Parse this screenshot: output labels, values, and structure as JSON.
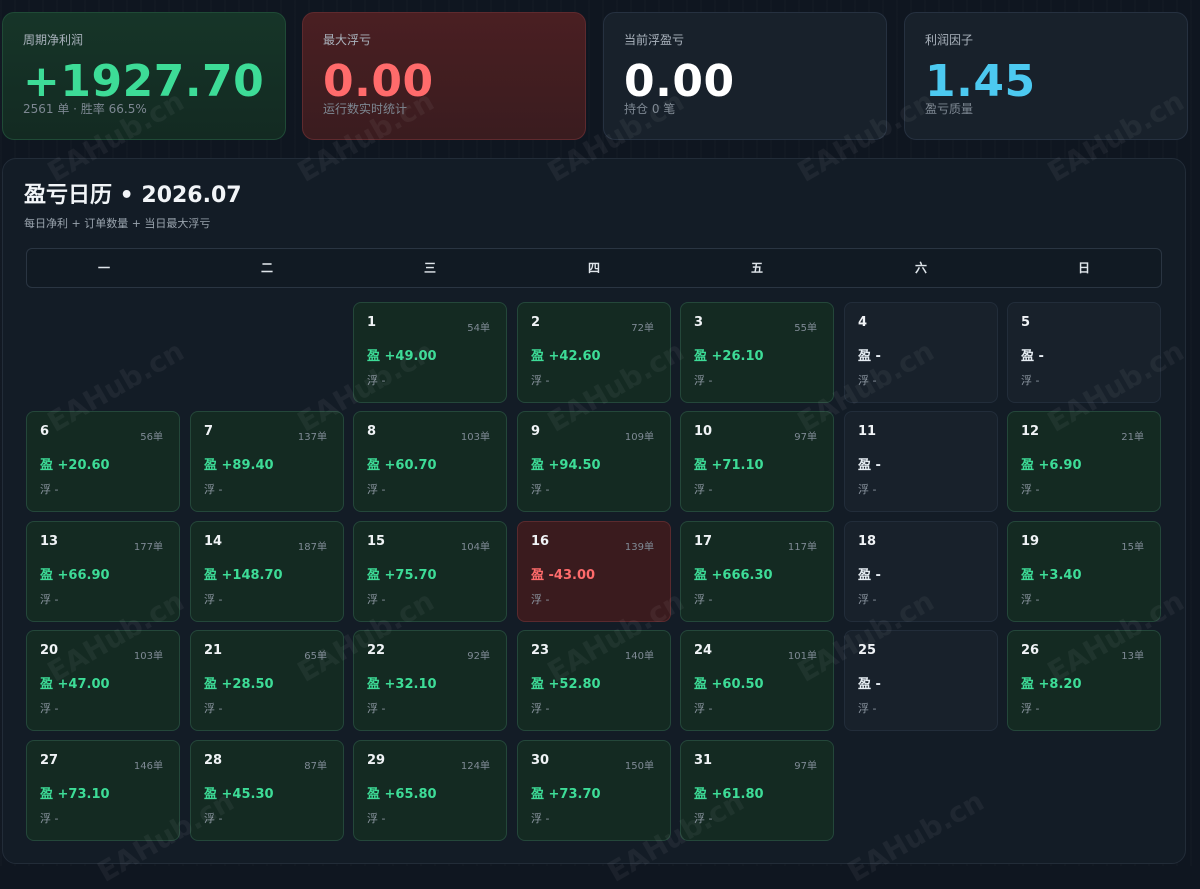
{
  "stats": [
    {
      "label": "周期净利润",
      "value": "+1927.70",
      "sub": "2561 单 · 胜率 66.5%"
    },
    {
      "label": "最大浮亏",
      "value": "0.00",
      "sub": "运行数实时统计"
    },
    {
      "label": "当前浮盈亏",
      "value": "0.00",
      "sub": "持仓 0 笔"
    },
    {
      "label": "利润因子",
      "value": "1.45",
      "sub": "盈亏质量"
    }
  ],
  "calendar": {
    "title": "盈亏日历 • 2026.07",
    "subtitle": "每日净利 + 订单数量 + 当日最大浮亏",
    "weekdays": [
      "一",
      "二",
      "三",
      "四",
      "五",
      "六",
      "日"
    ],
    "days": [
      {
        "d": "1",
        "orders": "54单",
        "pl": "盈 +49.00",
        "fl": "浮 -",
        "state": "profit"
      },
      {
        "d": "2",
        "orders": "72单",
        "pl": "盈 +42.60",
        "fl": "浮 -",
        "state": "profit"
      },
      {
        "d": "3",
        "orders": "55单",
        "pl": "盈 +26.10",
        "fl": "浮 -",
        "state": "profit"
      },
      {
        "d": "4",
        "orders": "",
        "pl": "盈 -",
        "fl": "浮 -",
        "state": "empty"
      },
      {
        "d": "5",
        "orders": "",
        "pl": "盈 -",
        "fl": "浮 -",
        "state": "empty"
      },
      {
        "d": "6",
        "orders": "56单",
        "pl": "盈 +20.60",
        "fl": "浮 -",
        "state": "profit"
      },
      {
        "d": "7",
        "orders": "137单",
        "pl": "盈 +89.40",
        "fl": "浮 -",
        "state": "profit"
      },
      {
        "d": "8",
        "orders": "103单",
        "pl": "盈 +60.70",
        "fl": "浮 -",
        "state": "profit"
      },
      {
        "d": "9",
        "orders": "109单",
        "pl": "盈 +94.50",
        "fl": "浮 -",
        "state": "profit"
      },
      {
        "d": "10",
        "orders": "97单",
        "pl": "盈 +71.10",
        "fl": "浮 -",
        "state": "profit"
      },
      {
        "d": "11",
        "orders": "",
        "pl": "盈 -",
        "fl": "浮 -",
        "state": "empty"
      },
      {
        "d": "12",
        "orders": "21单",
        "pl": "盈 +6.90",
        "fl": "浮 -",
        "state": "profit"
      },
      {
        "d": "13",
        "orders": "177单",
        "pl": "盈 +66.90",
        "fl": "浮 -",
        "state": "profit"
      },
      {
        "d": "14",
        "orders": "187单",
        "pl": "盈 +148.70",
        "fl": "浮 -",
        "state": "profit"
      },
      {
        "d": "15",
        "orders": "104单",
        "pl": "盈 +75.70",
        "fl": "浮 -",
        "state": "profit"
      },
      {
        "d": "16",
        "orders": "139单",
        "pl": "盈 -43.00",
        "fl": "浮 -",
        "state": "loss"
      },
      {
        "d": "17",
        "orders": "117单",
        "pl": "盈 +666.30",
        "fl": "浮 -",
        "state": "profit"
      },
      {
        "d": "18",
        "orders": "",
        "pl": "盈 -",
        "fl": "浮 -",
        "state": "empty"
      },
      {
        "d": "19",
        "orders": "15单",
        "pl": "盈 +3.40",
        "fl": "浮 -",
        "state": "profit"
      },
      {
        "d": "20",
        "orders": "103单",
        "pl": "盈 +47.00",
        "fl": "浮 -",
        "state": "profit"
      },
      {
        "d": "21",
        "orders": "65单",
        "pl": "盈 +28.50",
        "fl": "浮 -",
        "state": "profit"
      },
      {
        "d": "22",
        "orders": "92单",
        "pl": "盈 +32.10",
        "fl": "浮 -",
        "state": "profit"
      },
      {
        "d": "23",
        "orders": "140单",
        "pl": "盈 +52.80",
        "fl": "浮 -",
        "state": "profit"
      },
      {
        "d": "24",
        "orders": "101单",
        "pl": "盈 +60.50",
        "fl": "浮 -",
        "state": "profit"
      },
      {
        "d": "25",
        "orders": "",
        "pl": "盈 -",
        "fl": "浮 -",
        "state": "empty"
      },
      {
        "d": "26",
        "orders": "13单",
        "pl": "盈 +8.20",
        "fl": "浮 -",
        "state": "profit"
      },
      {
        "d": "27",
        "orders": "146单",
        "pl": "盈 +73.10",
        "fl": "浮 -",
        "state": "profit"
      },
      {
        "d": "28",
        "orders": "87单",
        "pl": "盈 +45.30",
        "fl": "浮 -",
        "state": "profit"
      },
      {
        "d": "29",
        "orders": "124单",
        "pl": "盈 +65.80",
        "fl": "浮 -",
        "state": "profit"
      },
      {
        "d": "30",
        "orders": "150单",
        "pl": "盈 +73.70",
        "fl": "浮 -",
        "state": "profit"
      },
      {
        "d": "31",
        "orders": "97单",
        "pl": "盈 +61.80",
        "fl": "浮 -",
        "state": "profit"
      }
    ]
  },
  "watermark": "EAHub.cn",
  "colors": {
    "profit": "#3ddc97",
    "loss": "#ff6b6b",
    "factor": "#4cc9f0"
  }
}
